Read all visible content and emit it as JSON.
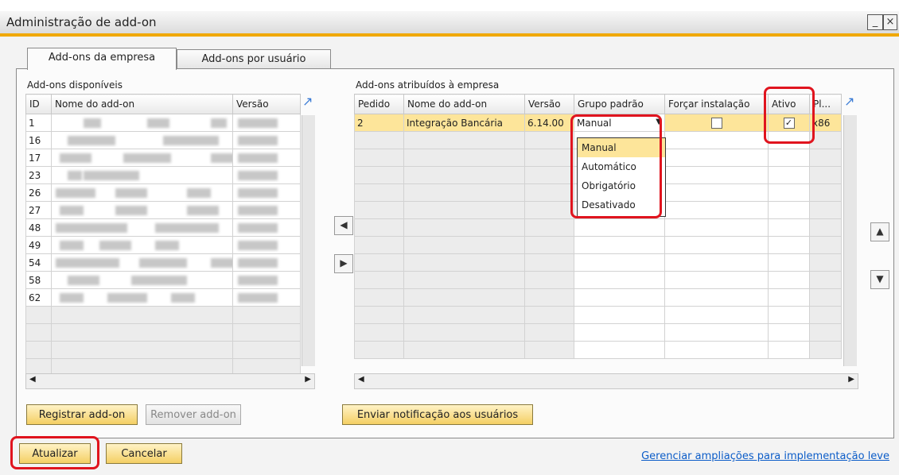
{
  "window": {
    "title": "Administração de add-on",
    "minimize_glyph": "_",
    "close_glyph": "×"
  },
  "tabs": [
    {
      "label": "Add-ons da empresa",
      "active": true
    },
    {
      "label": "Add-ons por usuário",
      "active": false
    }
  ],
  "left": {
    "title": "Add-ons disponíveis",
    "columns": [
      "ID",
      "Nome do add-on",
      "Versão"
    ],
    "rows": [
      {
        "id": "1"
      },
      {
        "id": "16"
      },
      {
        "id": "17"
      },
      {
        "id": "23"
      },
      {
        "id": "26"
      },
      {
        "id": "27"
      },
      {
        "id": "48"
      },
      {
        "id": "49"
      },
      {
        "id": "54"
      },
      {
        "id": "58"
      },
      {
        "id": "62"
      }
    ],
    "register_label": "Registrar add-on",
    "remove_label": "Remover add-on"
  },
  "right": {
    "title": "Add-ons atribuídos à empresa",
    "columns": [
      "Pedido",
      "Nome do add-on",
      "Versão",
      "Grupo padrão",
      "Forçar instalação",
      "Ativo",
      "Pl..."
    ],
    "row": {
      "pedido": "2",
      "name": "Integração Bancária",
      "version": "6.14.00",
      "group": "Manual",
      "force": false,
      "active": true,
      "platform": "x86"
    },
    "dropdown_options": [
      "Manual",
      "Automático",
      "Obrigatório",
      "Desativado"
    ],
    "notify_label": "Enviar notificação aos usuários"
  },
  "footer": {
    "update_label": "Atualizar",
    "cancel_label": "Cancelar",
    "link_text": "Gerenciar ampliações para implementação leve"
  },
  "colors": {
    "accent": "#f0a800",
    "selected_row": "#fde59a",
    "highlight": "#e0141e"
  }
}
